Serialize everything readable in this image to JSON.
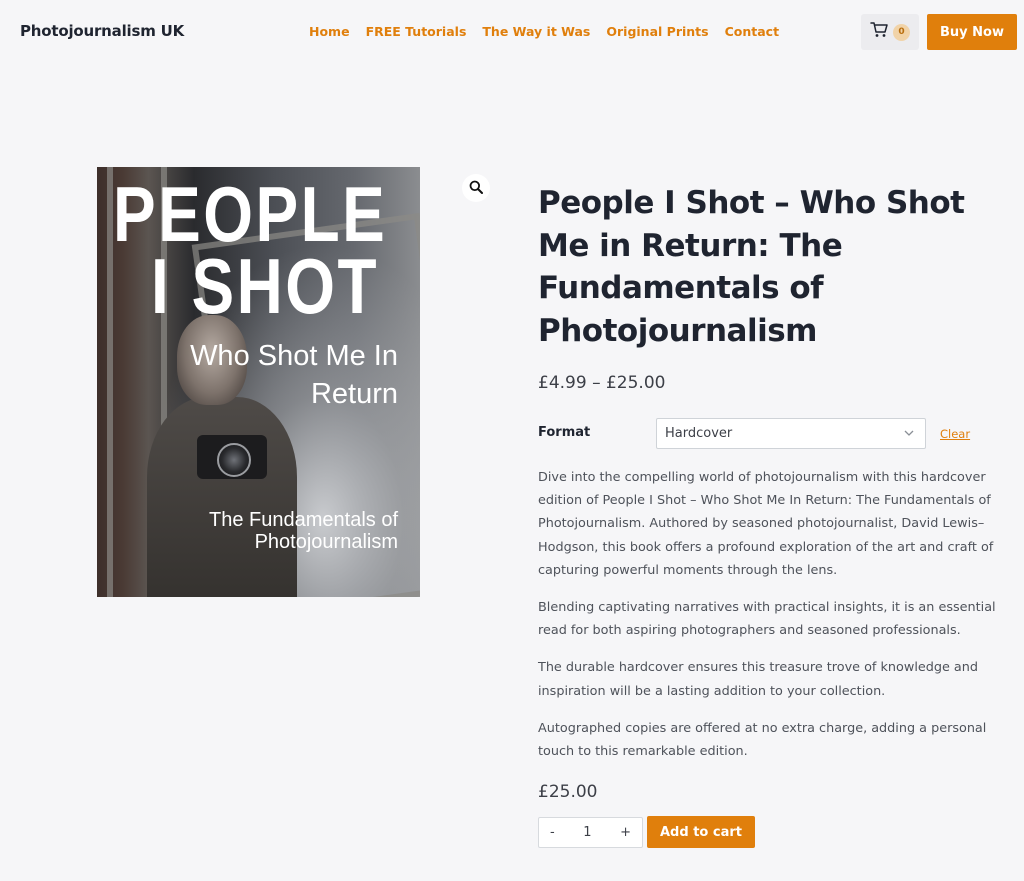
{
  "header": {
    "site_title": "Photojournalism UK",
    "nav": [
      "Home",
      "FREE Tutorials",
      "The Way it Was",
      "Original Prints",
      "Contact"
    ],
    "cart_count": "0",
    "buy_now_label": "Buy Now"
  },
  "product": {
    "cover": {
      "line1": "PEOPLE",
      "line2": "I SHOT",
      "subtitle": "Who Shot Me In Return",
      "tagline": "The Fundamentals of Photojournalism"
    },
    "title": "People I Shot – Who Shot Me in Return: The Fundamentals of Photojournalism",
    "price_range": "£4.99 – £25.00",
    "format_label": "Format",
    "format_value": "Hardcover",
    "clear_label": "Clear",
    "description": [
      "Dive into the compelling world of photojournalism with this hardcover edition of People I Shot – Who Shot Me In Return: The Fundamentals of Photojournalism. Authored by seasoned photojournalist, David Lewis–Hodgson, this book offers a profound exploration of the art and craft of capturing powerful moments through the lens.",
      "Blending captivating narratives with practical insights, it is an essential read for both aspiring photographers and seasoned professionals.",
      "The durable hardcover ensures this treasure trove of knowledge and inspiration will be a lasting addition to your collection.",
      "Autographed copies are offered at no extra charge, adding a personal touch to this remarkable edition."
    ],
    "price": "£25.00",
    "quantity": {
      "minus": "-",
      "value": "1",
      "plus": "+"
    },
    "add_to_cart_label": "Add to cart"
  },
  "colors": {
    "accent": "#e07f0c",
    "background": "#f6f6f8",
    "heading": "#1f2430"
  }
}
